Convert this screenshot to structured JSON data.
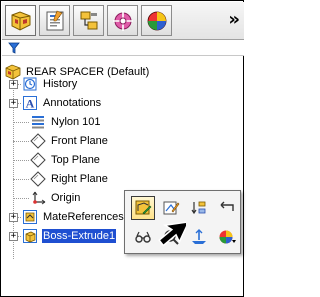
{
  "tabs": [
    {
      "icon": "featuremanager-tree-icon"
    },
    {
      "icon": "propertymanager-icon"
    },
    {
      "icon": "configurationmanager-icon"
    },
    {
      "icon": "dimxpert-manager-icon"
    },
    {
      "icon": "display-manager-icon"
    }
  ],
  "more_tabs_label": "»",
  "filter_icon": "filter-icon",
  "tree": {
    "root_label": "REAR SPACER  (Default)",
    "items": [
      {
        "label": "History",
        "icon": "history-icon",
        "expander": "+"
      },
      {
        "label": "Annotations",
        "icon": "annotations-icon",
        "expander": "+"
      },
      {
        "label": "Nylon 101",
        "icon": "material-icon"
      },
      {
        "label": "Front Plane",
        "icon": "plane-icon"
      },
      {
        "label": "Top Plane",
        "icon": "plane-icon"
      },
      {
        "label": "Right Plane",
        "icon": "plane-icon"
      },
      {
        "label": "Origin",
        "icon": "origin-icon"
      },
      {
        "label": "MateReferences",
        "icon": "mate-references-icon",
        "expander": "+"
      },
      {
        "label": "Boss-Extrude1",
        "icon": "extrude-icon",
        "expander": "+",
        "selected": true
      }
    ]
  },
  "context_toolbar": {
    "buttons": [
      "edit-feature-icon",
      "edit-sketch-icon",
      "rollback-icon",
      "rollback-arrow-icon",
      "hide-show-icon",
      "zoom-to-selection-icon",
      "normal-to-icon",
      "appearance-icon"
    ]
  },
  "colors": {
    "selection": "#1f4fd1",
    "tab_bg": "#e4e4e4"
  }
}
